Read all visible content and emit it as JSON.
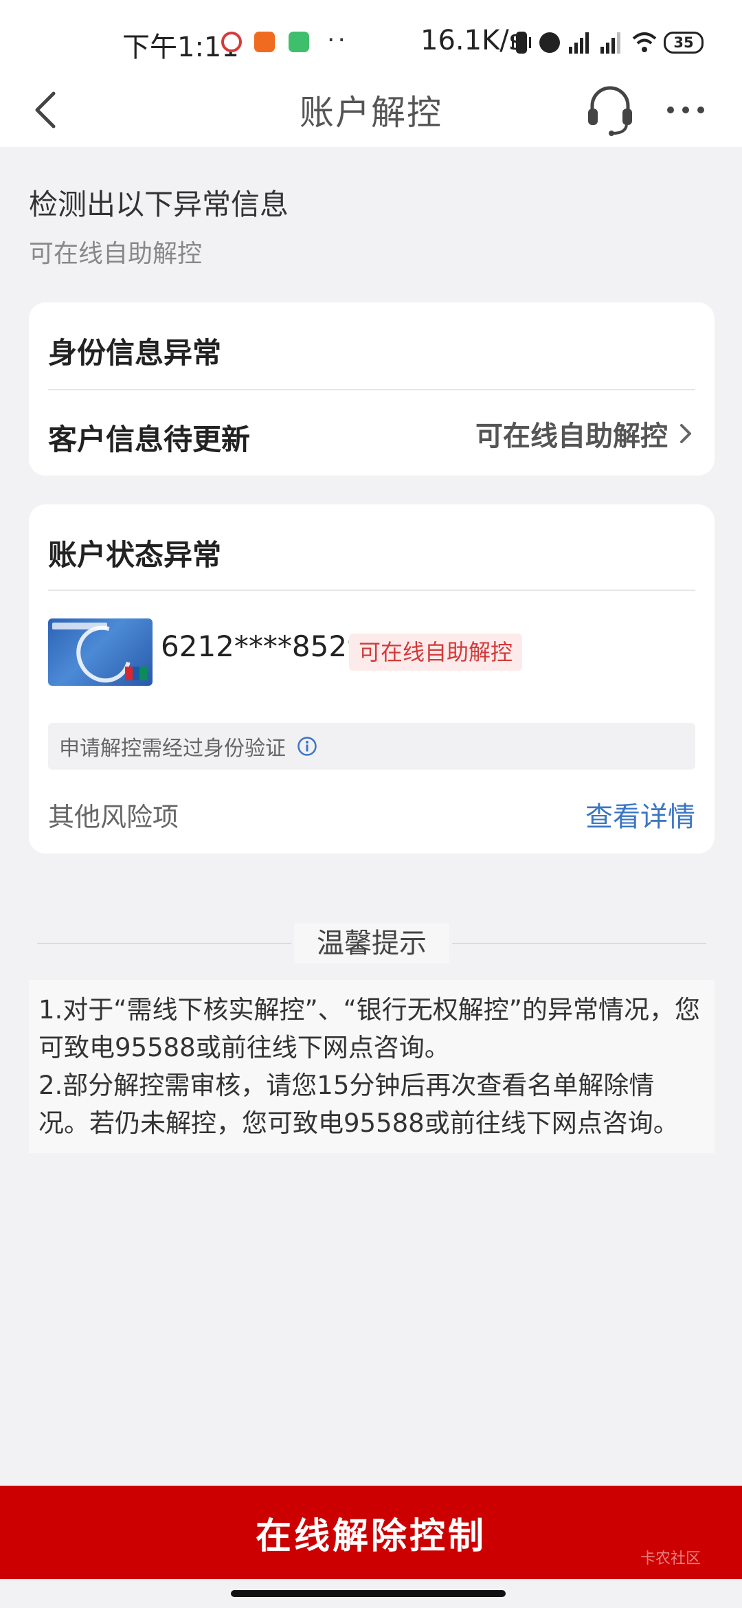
{
  "status_bar": {
    "time": "下午1:11",
    "network_speed": "16.1K/s",
    "battery": "35",
    "app_icons": [
      {
        "name": "china-merchants-icon",
        "color": "#d63b3b"
      },
      {
        "name": "taobao-icon",
        "color": "#f06a1f"
      },
      {
        "name": "security-app-icon",
        "color": "#3fbf6b"
      }
    ]
  },
  "nav": {
    "title": "账户解控"
  },
  "header": {
    "title": "检测出以下异常信息",
    "subtitle": "可在线自助解控"
  },
  "identity_card": {
    "heading": "身份信息异常",
    "row_label": "客户信息待更新",
    "row_action": "可在线自助解控"
  },
  "account_card": {
    "heading": "账户状态异常",
    "card_number": "6212****8529",
    "badge": "可在线自助解控",
    "verify_note": "申请解控需经过身份验证",
    "other_label": "其他风险项",
    "detail_link": "查看详情"
  },
  "tips": {
    "title": "温馨提示",
    "line1": "1.对于“需线下核实解控”、“银行无权解控”的异常情况，您可致电95588或前往线下网点咨询。",
    "line2": "2.部分解控需审核，请您15分钟后再次查看名单解除情况。若仍未解控，您可致电95588或前往线下网点咨询。"
  },
  "footer": {
    "button_label": "在线解除控制",
    "watermark": "卡农社区"
  },
  "colors": {
    "brand_red": "#cc0000",
    "link_blue": "#3a76c4",
    "badge_red": "#d33a3a"
  }
}
